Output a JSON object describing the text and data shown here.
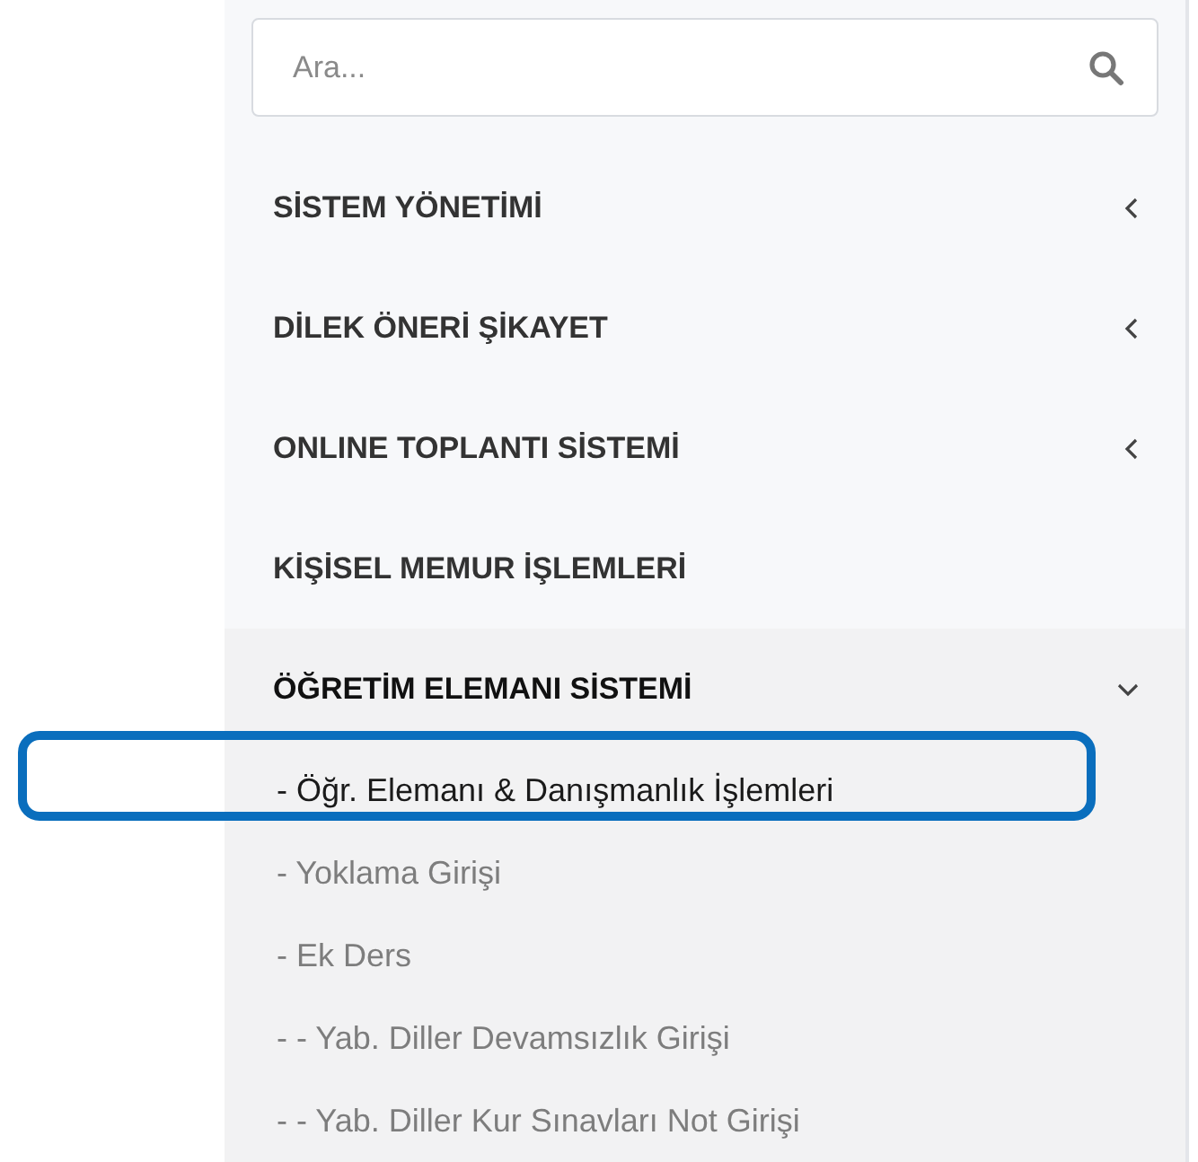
{
  "search": {
    "placeholder": "Ara..."
  },
  "menu": [
    {
      "kind": "group",
      "label": "SİSTEM YÖNETİMİ",
      "expanded": false
    },
    {
      "kind": "group",
      "label": "DİLEK ÖNERİ ŞİKAYET",
      "expanded": false
    },
    {
      "kind": "group",
      "label": "ONLINE TOPLANTI SİSTEMİ",
      "expanded": false
    },
    {
      "kind": "link",
      "label": "KİŞİSEL MEMUR İŞLEMLERİ"
    },
    {
      "kind": "group",
      "label": "ÖĞRETİM ELEMANI SİSTEMİ",
      "expanded": true,
      "children": [
        {
          "label": "- Öğr. Elemanı & Danışmanlık İşlemleri",
          "selected": true,
          "annotated": true
        },
        {
          "label": "- Yoklama Girişi",
          "selected": false,
          "annotated": false
        },
        {
          "label": "- Ek Ders",
          "selected": false,
          "annotated": false
        },
        {
          "label": "- - Yab. Diller Devamsızlık Girişi",
          "selected": false,
          "annotated": false
        },
        {
          "label": "- - Yab. Diller Kur Sınavları Not Girişi",
          "selected": false,
          "annotated": false
        }
      ]
    }
  ]
}
